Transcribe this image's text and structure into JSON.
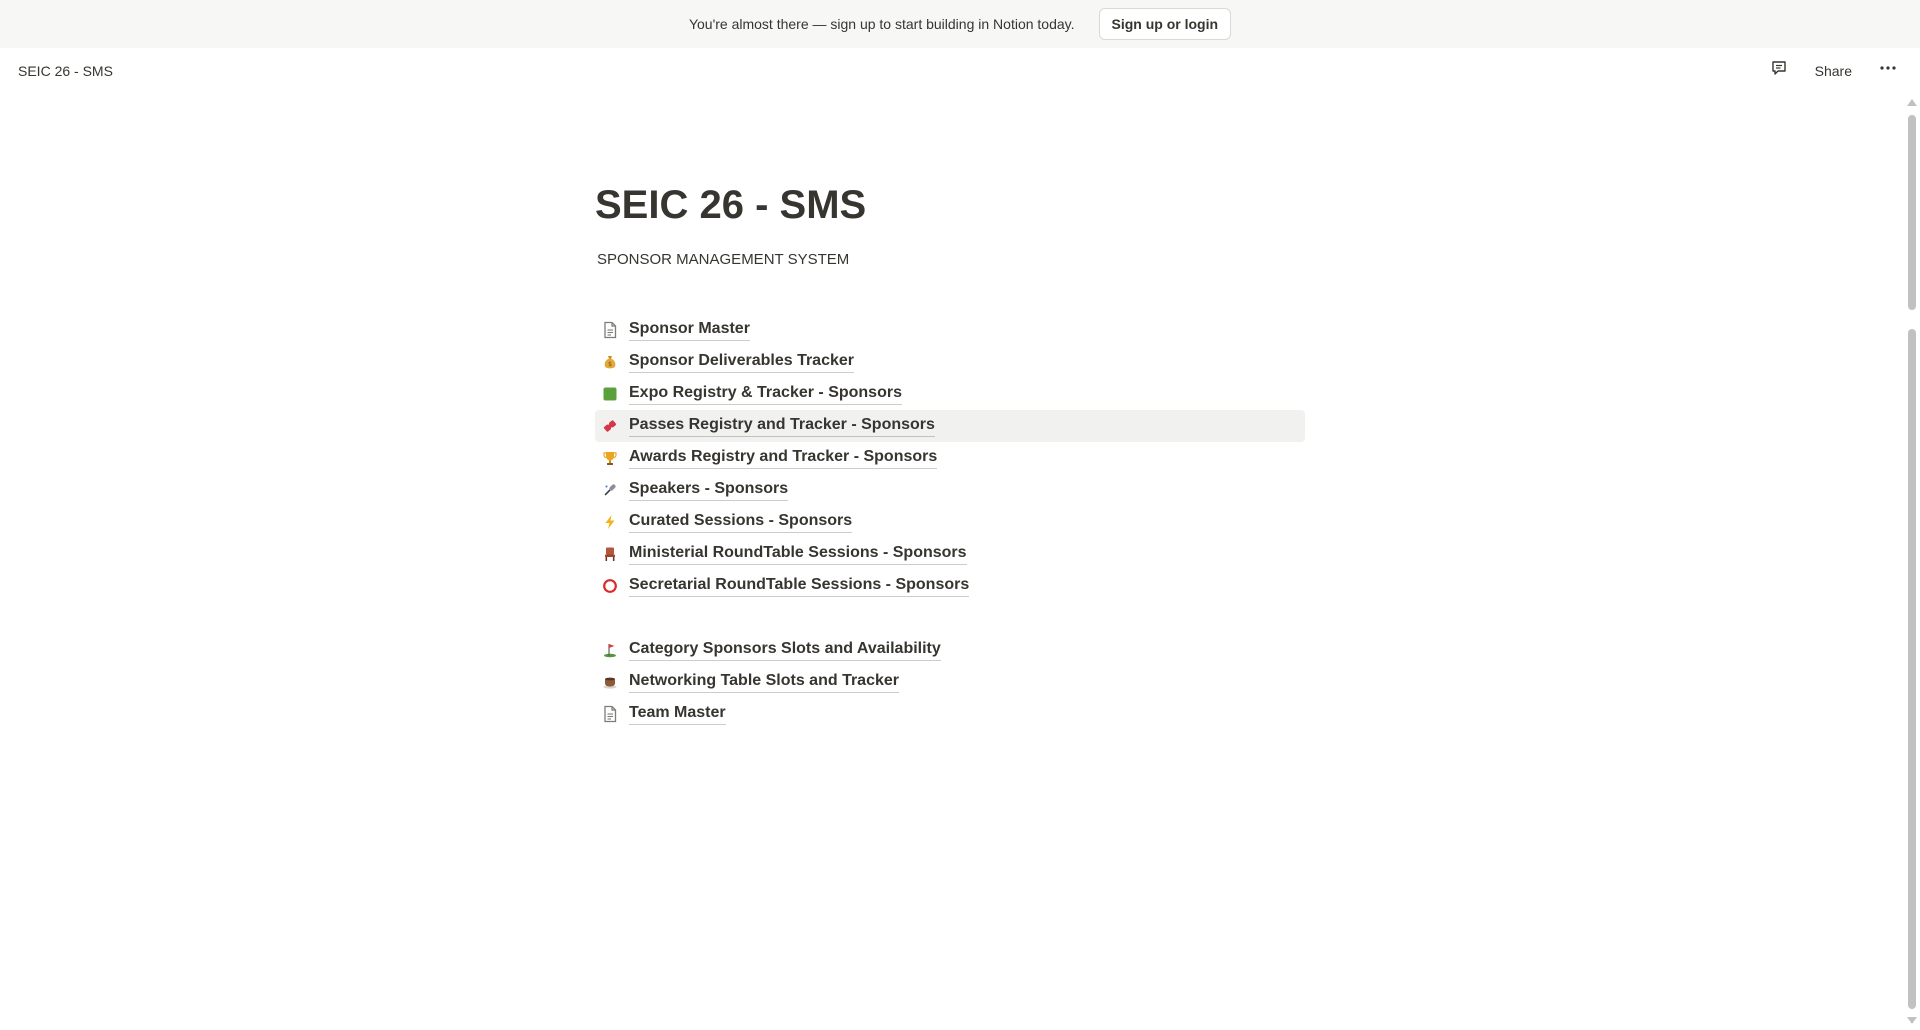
{
  "banner": {
    "text": "You're almost there — sign up to start building in Notion today.",
    "button_label": "Sign up or login"
  },
  "topbar": {
    "breadcrumb": "SEIC 26 - SMS",
    "share_label": "Share"
  },
  "page": {
    "title": "SEIC 26 - SMS",
    "subtitle": "SPONSOR MANAGEMENT SYSTEM"
  },
  "links_group1": [
    {
      "icon": "page-icon",
      "label": "Sponsor Master"
    },
    {
      "icon": "money-bag-icon",
      "label": "Sponsor Deliverables Tracker"
    },
    {
      "icon": "green-square-icon",
      "label": "Expo Registry & Tracker - Sponsors"
    },
    {
      "icon": "ticket-icon",
      "label": "Passes Registry and Tracker - Sponsors"
    },
    {
      "icon": "trophy-icon",
      "label": "Awards Registry and Tracker - Sponsors"
    },
    {
      "icon": "microphone-icon",
      "label": "Speakers - Sponsors"
    },
    {
      "icon": "lightning-icon",
      "label": "Curated Sessions - Sponsors"
    },
    {
      "icon": "chair-icon",
      "label": "Ministerial RoundTable Sessions - Sponsors"
    },
    {
      "icon": "red-circle-icon",
      "label": "Secretarial RoundTable Sessions - Sponsors"
    }
  ],
  "links_group2": [
    {
      "icon": "flag-icon",
      "label": "Category Sponsors Slots and Availability"
    },
    {
      "icon": "coffee-icon",
      "label": "Networking Table Slots and Tracker"
    },
    {
      "icon": "page-icon",
      "label": "Team Master"
    }
  ]
}
